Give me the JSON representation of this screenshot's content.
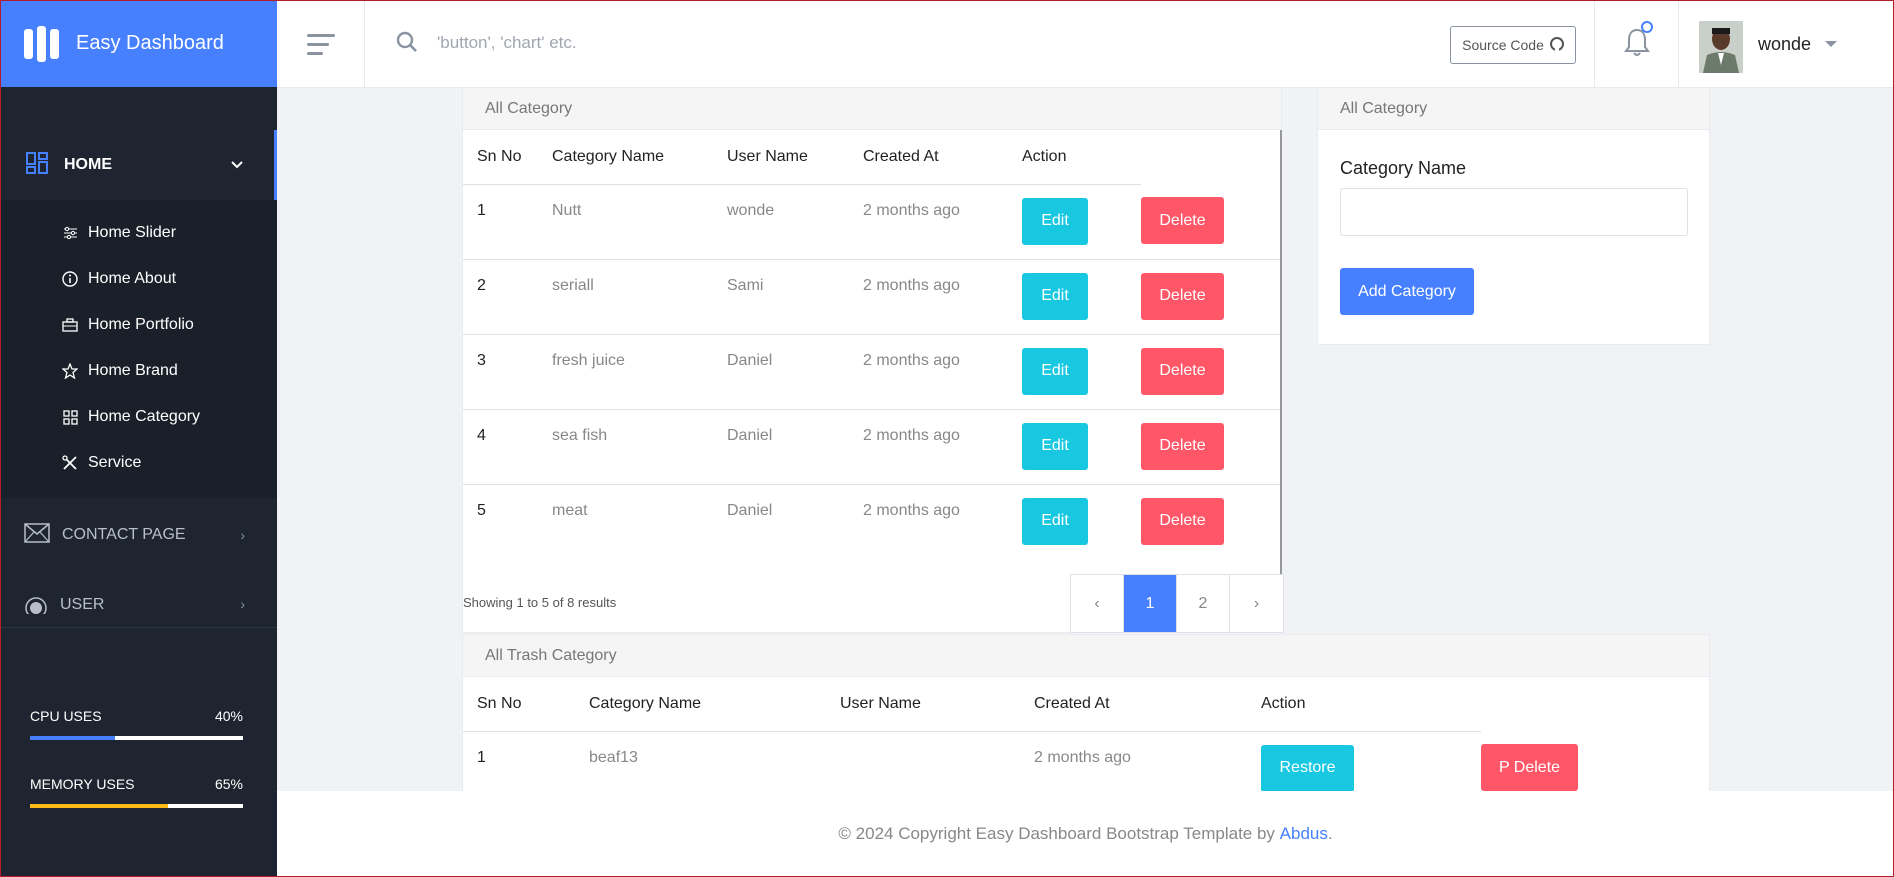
{
  "brand": {
    "title": "Easy Dashboard"
  },
  "sidebar": {
    "home_label": "HOME",
    "submenu": [
      {
        "label": "Home Slider",
        "icon": "sliders-icon"
      },
      {
        "label": "Home About",
        "icon": "info-icon"
      },
      {
        "label": "Home Portfolio",
        "icon": "briefcase-icon"
      },
      {
        "label": "Home Brand",
        "icon": "star-icon"
      },
      {
        "label": "Home Category",
        "icon": "grid-icon"
      },
      {
        "label": "Service",
        "icon": "tools-icon"
      }
    ],
    "contact_label": "CONTACT PAGE",
    "user_label": "USER",
    "cpu": {
      "label": "CPU USES",
      "value": "40%",
      "fraction": 0.4,
      "color": "#4680ff"
    },
    "memory": {
      "label": "MEMORY USES",
      "value": "65%",
      "fraction": 0.65,
      "color": "#ffba19"
    }
  },
  "header": {
    "search_placeholder": "'button', 'chart' etc.",
    "source_code_label": "Source Code",
    "user_name": "wonde"
  },
  "category_table": {
    "title": "All Category",
    "columns": [
      "Sn No",
      "Category Name",
      "User Name",
      "Created At",
      "Action"
    ],
    "rows": [
      {
        "sn": "1",
        "name": "Nutt",
        "user": "wonde",
        "created": "2 months ago"
      },
      {
        "sn": "2",
        "name": "seriall",
        "user": "Sami",
        "created": "2 months ago"
      },
      {
        "sn": "3",
        "name": "fresh juice",
        "user": "Daniel",
        "created": "2 months ago"
      },
      {
        "sn": "4",
        "name": "sea fish",
        "user": "Daniel",
        "created": "2 months ago"
      },
      {
        "sn": "5",
        "name": "meat",
        "user": "Daniel",
        "created": "2 months ago"
      }
    ],
    "edit_label": "Edit",
    "delete_label": "Delete",
    "showing": "Showing 1 to 5 of 8 results",
    "pagination": {
      "prev": "‹",
      "pages": [
        "1",
        "2"
      ],
      "active": "1",
      "next": "›"
    }
  },
  "add_form": {
    "title": "All Category",
    "field_label": "Category Name",
    "field_value": "",
    "submit_label": "Add Category"
  },
  "trash_table": {
    "title": "All Trash Category",
    "columns": [
      "Sn No",
      "Category Name",
      "User Name",
      "Created At",
      "Action"
    ],
    "rows": [
      {
        "sn": "1",
        "name": "beaf13",
        "user": "",
        "created": "2 months ago"
      }
    ],
    "restore_label": "Restore",
    "pdelete_label": "P Delete"
  },
  "footer": {
    "text": "© 2024 Copyright Easy Dashboard Bootstrap Template by ",
    "author": "Abdus",
    "end": "."
  }
}
